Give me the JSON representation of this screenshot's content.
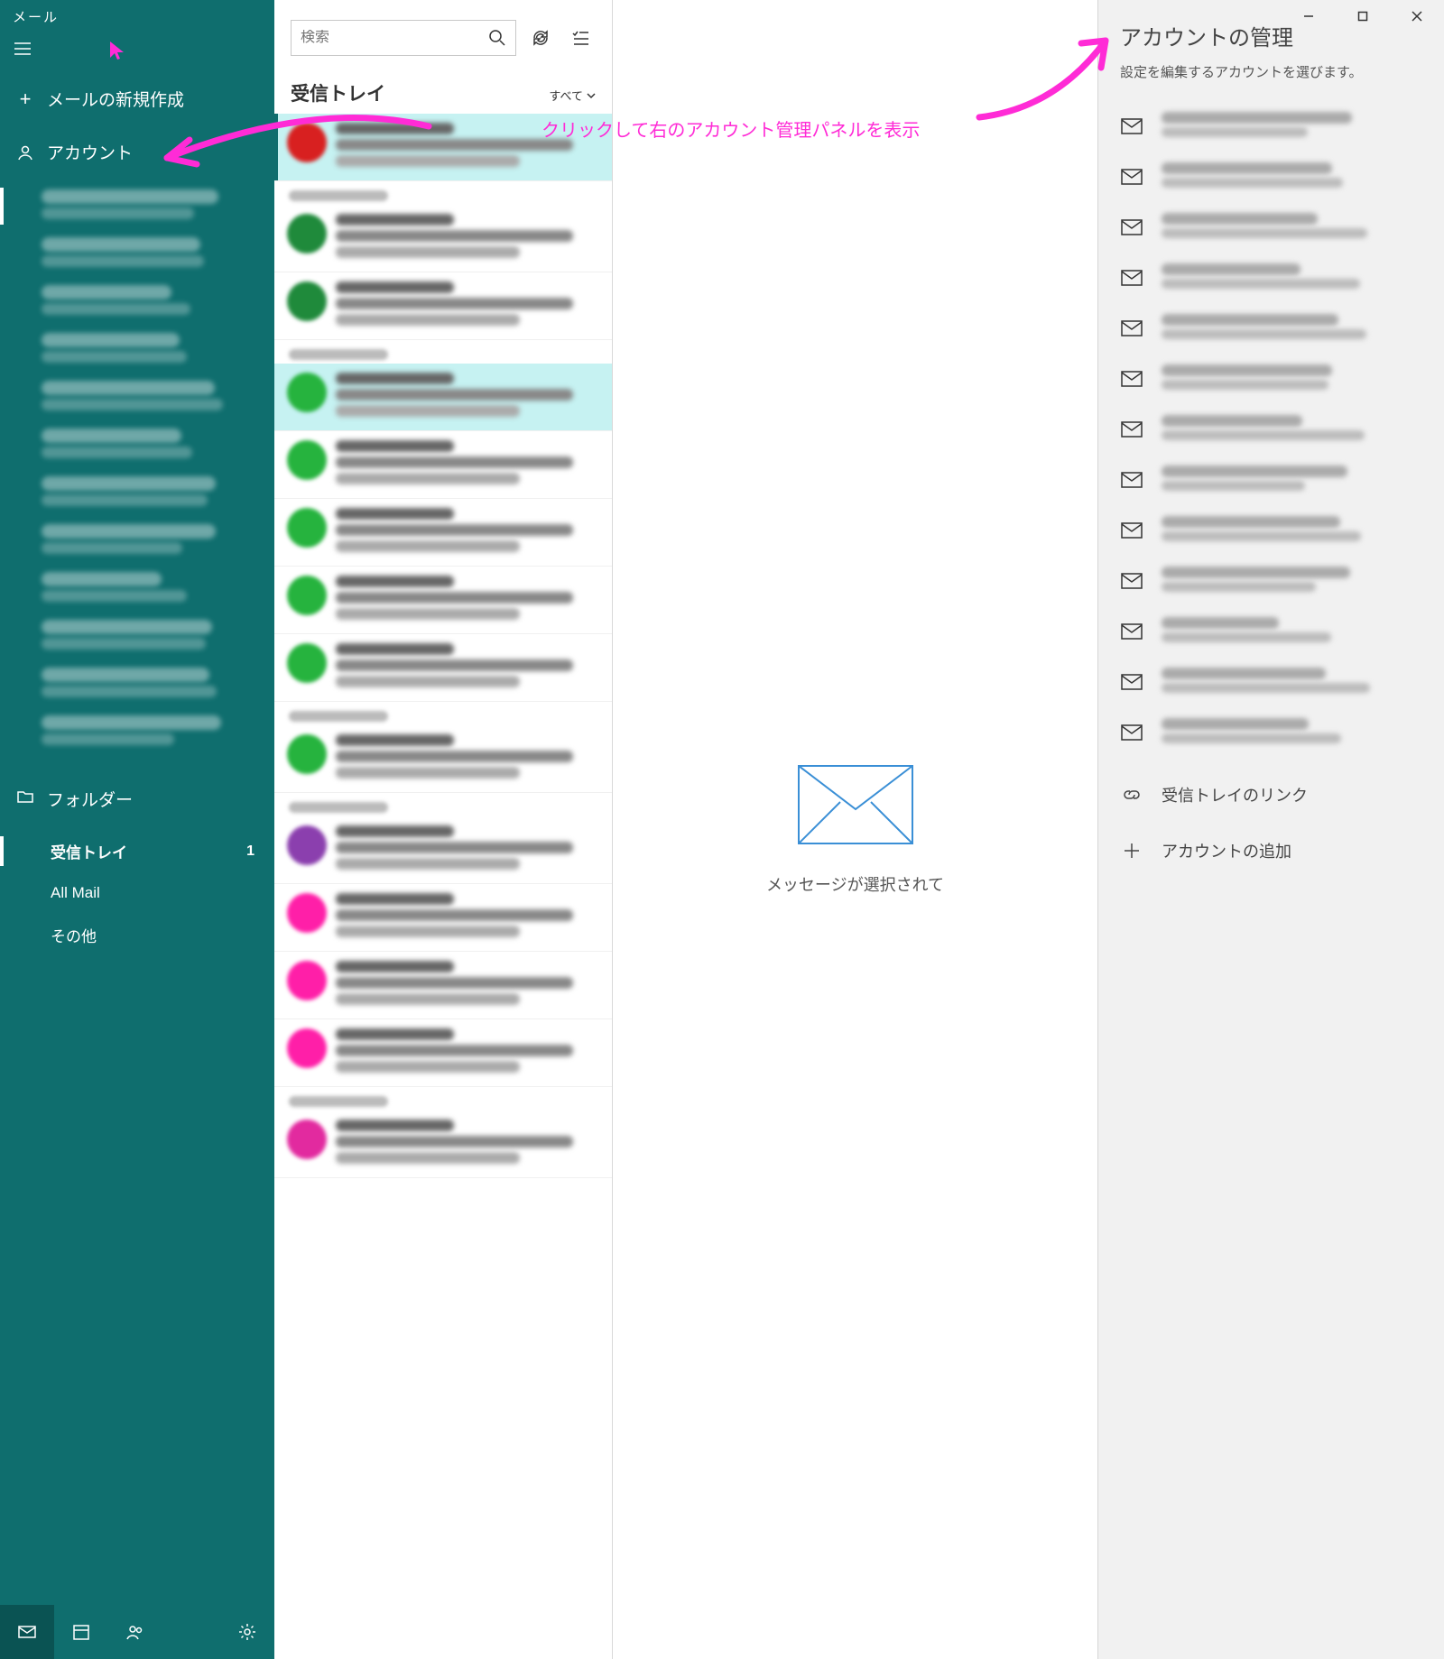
{
  "app_title": "メール",
  "titlebar": {
    "minimize": "—",
    "maximize": "□",
    "close": "✕"
  },
  "sidebar": {
    "new_mail": "メールの新規作成",
    "accounts_header": "アカウント",
    "folders_header": "フォルダー",
    "folders": [
      {
        "label": "受信トレイ",
        "count": "1"
      },
      {
        "label": "All Mail",
        "count": ""
      },
      {
        "label": "その他",
        "count": ""
      }
    ],
    "account_count": 12
  },
  "list": {
    "search_placeholder": "検索",
    "header": "受信トレイ",
    "filter": "すべて",
    "msgs": [
      {
        "color": "#d82020",
        "selected": true
      },
      {
        "sep": true
      },
      {
        "color": "#1f8a3b"
      },
      {
        "color": "#1f8a3b"
      },
      {
        "sep": true
      },
      {
        "color": "#26b33e",
        "highlighted": true
      },
      {
        "color": "#26b33e"
      },
      {
        "color": "#26b33e"
      },
      {
        "color": "#26b33e"
      },
      {
        "color": "#26b33e"
      },
      {
        "sep": true
      },
      {
        "color": "#26b33e"
      },
      {
        "sep": true
      },
      {
        "color": "#8b3fae"
      },
      {
        "color": "#ff1fa8"
      },
      {
        "color": "#ff1fa8"
      },
      {
        "color": "#ff1fa8"
      },
      {
        "sep": true
      },
      {
        "color": "#e22a9f"
      }
    ]
  },
  "reading": {
    "empty_text": "メッセージが選択されて"
  },
  "account_panel": {
    "title": "アカウントの管理",
    "subtitle": "設定を編集するアカウントを選びます。",
    "account_count": 13,
    "link_inbox": "受信トレイのリンク",
    "add_account": "アカウントの追加"
  },
  "annotation": {
    "text": "クリックして右のアカウント管理パネルを表示"
  }
}
